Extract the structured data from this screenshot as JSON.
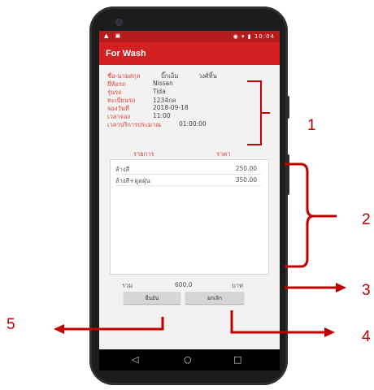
{
  "status_bar": {
    "left_icons": "▲ ▣",
    "right_icons": "◉ ▾ ▮",
    "time": "10:04"
  },
  "app_bar": {
    "title": "For Wash"
  },
  "booking_info": {
    "name": {
      "label": "ชื่อ-นามสกุล",
      "first": "บิ๊กเอ็ม",
      "last": "วงศ์ทิ้น"
    },
    "rows": [
      {
        "label": "ยี่ห้อรถ",
        "value": "Nissan"
      },
      {
        "label": "รุ่นรถ",
        "value": "Tida"
      },
      {
        "label": "ทะเบียนรถ",
        "value": "1234กค"
      },
      {
        "label": "จองวันที่",
        "value": "2018-09-18"
      },
      {
        "label": "เวลาจอง",
        "value": "11:00"
      },
      {
        "label": "เวลาบริการประมาณ",
        "value": "01:00:00"
      }
    ]
  },
  "service_list": {
    "header_item": "รายการ",
    "header_price": "ราคา",
    "items": [
      {
        "name": "ล้างสี",
        "price": "250.00"
      },
      {
        "name": "ล้างสี+ดูดฝุ่น",
        "price": "350.00"
      }
    ]
  },
  "total": {
    "label": "รวม",
    "value": "600.0",
    "unit": "บาท"
  },
  "buttons": {
    "confirm": "ยืนยัน",
    "cancel": "ยกเลิก"
  },
  "navigation": {
    "back": "◁",
    "home": "○",
    "recents": "□"
  },
  "annotations": {
    "label_1": "1",
    "label_2": "2",
    "label_3": "3",
    "label_4": "4",
    "label_5": "5",
    "color": "#c00000"
  },
  "colors": {
    "app_bar": "#d32121",
    "status_bar": "#b71c1c",
    "label_text": "#e53935"
  }
}
